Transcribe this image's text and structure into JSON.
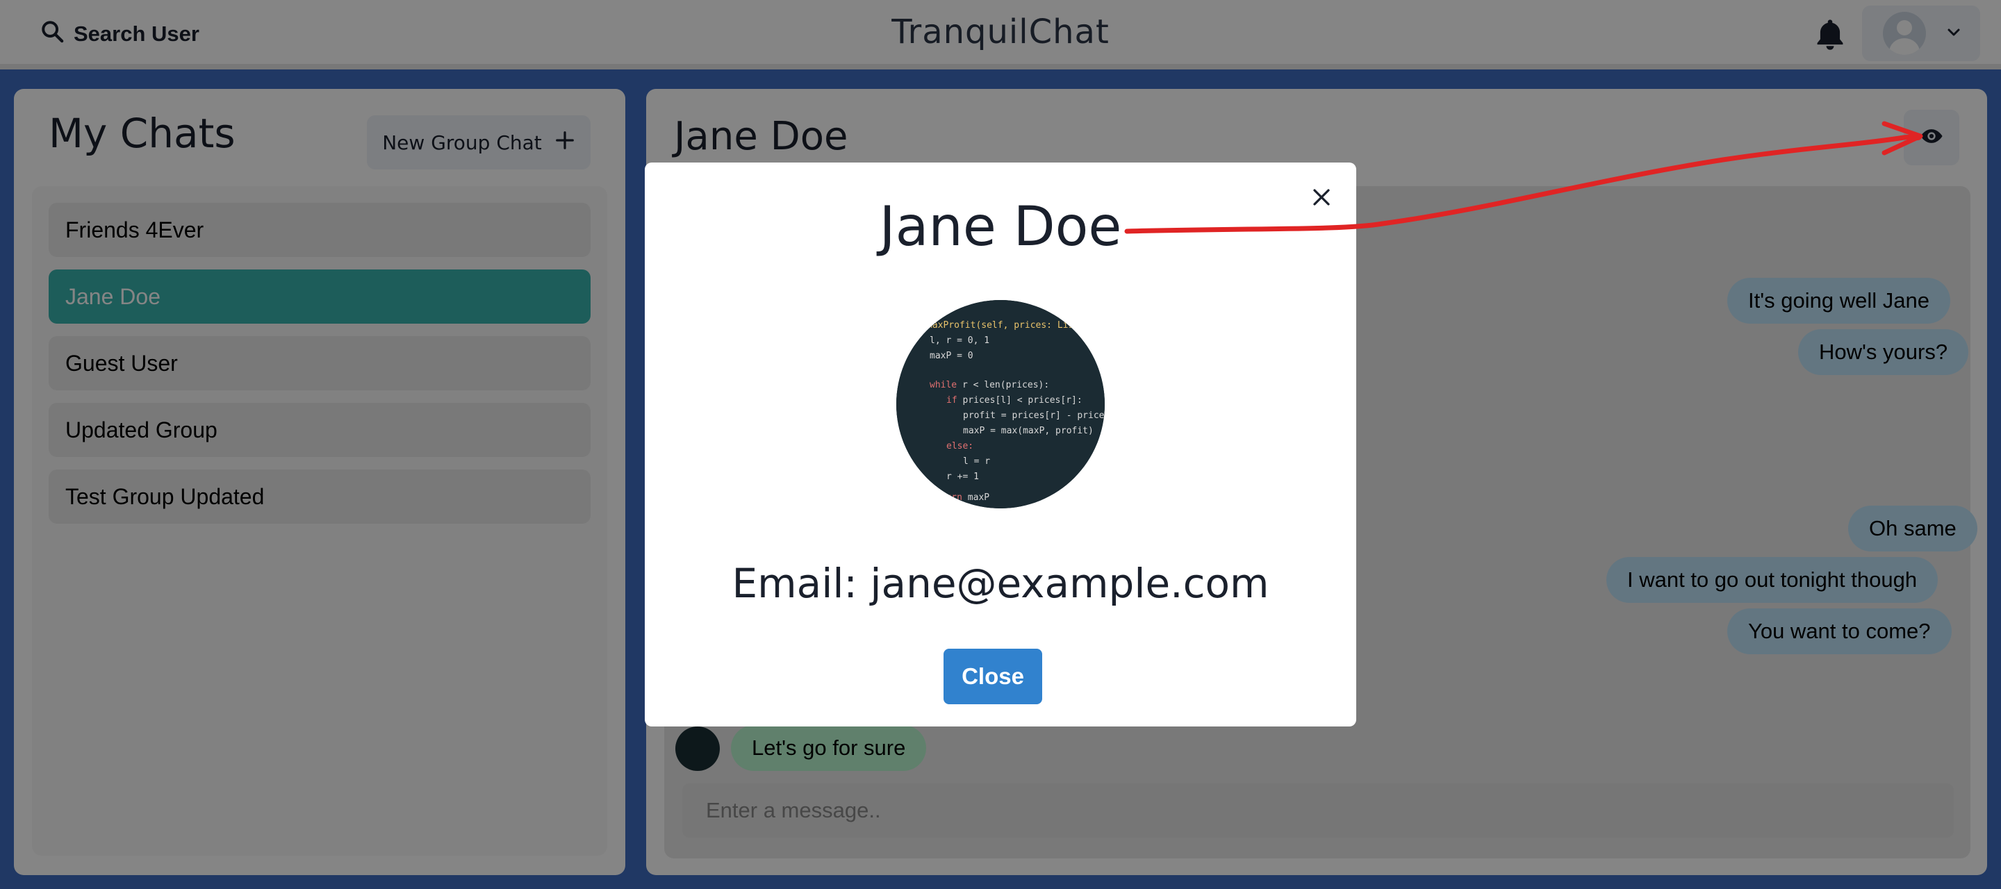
{
  "header": {
    "search_label": "Search User",
    "brand": "TranquilChat",
    "icons": [
      "search-icon",
      "bell-icon",
      "user-avatar-icon",
      "chevron-down-icon"
    ]
  },
  "sidebar": {
    "title": "My Chats",
    "new_group_label": "New Group Chat",
    "items": [
      {
        "label": "Friends 4Ever",
        "active": false
      },
      {
        "label": "Jane Doe",
        "active": true
      },
      {
        "label": "Guest User",
        "active": false
      },
      {
        "label": "Updated Group",
        "active": false
      },
      {
        "label": "Test Group Updated",
        "active": false
      }
    ]
  },
  "chat": {
    "title": "Jane Doe",
    "messages": [
      {
        "text": "It's going well Jane",
        "sender": "me"
      },
      {
        "text": "How's yours?",
        "sender": "me"
      },
      {
        "text": "Oh same",
        "sender": "me"
      },
      {
        "text": "I want to go out tonight though",
        "sender": "me"
      },
      {
        "text": "You want to come?",
        "sender": "me"
      },
      {
        "text": "Let's go for sure",
        "sender": "other"
      }
    ],
    "input_placeholder": "Enter a message.."
  },
  "modal": {
    "name": "Jane Doe",
    "email": "Email: jane@example.com",
    "close_label": "Close"
  },
  "colors": {
    "page_background": "#3f6bc0",
    "active_chat": "#38b2ac",
    "my_bubble": "#bee3f8",
    "their_bubble": "#b9f5d0",
    "primary_button": "#3182ce",
    "annotation": "#e02424"
  }
}
